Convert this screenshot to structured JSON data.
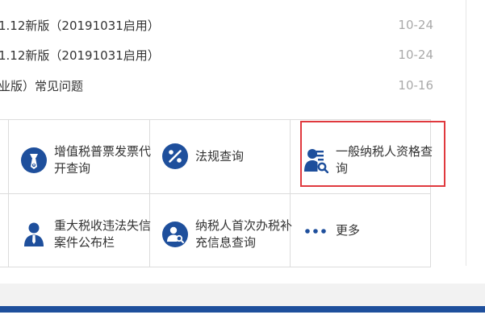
{
  "news": [
    {
      "title": "1.12新版（20191031启用）",
      "date": "10-24"
    },
    {
      "title": "1.12新版（20191031启用）",
      "date": "10-24"
    },
    {
      "title": "业版）常见问题",
      "date": "10-16"
    }
  ],
  "services": [
    {
      "label": "增值税普票发票代开查询",
      "icon": "tie-person-icon"
    },
    {
      "label": "法规查询",
      "icon": "percent-icon"
    },
    {
      "label": "一般纳税人资格查询",
      "icon": "person-search-icon"
    },
    {
      "label": "重大税收违法失信案件公布栏",
      "icon": "person-icon"
    },
    {
      "label": "纳税人首次办税补充信息查询",
      "icon": "person-search-circle-icon"
    },
    {
      "label": "更多",
      "icon": "ellipsis-icon"
    }
  ],
  "colors": {
    "icon_blue": "#1e4f9c",
    "highlight_red": "#e0393e",
    "date_gray": "#aaaaaa"
  }
}
